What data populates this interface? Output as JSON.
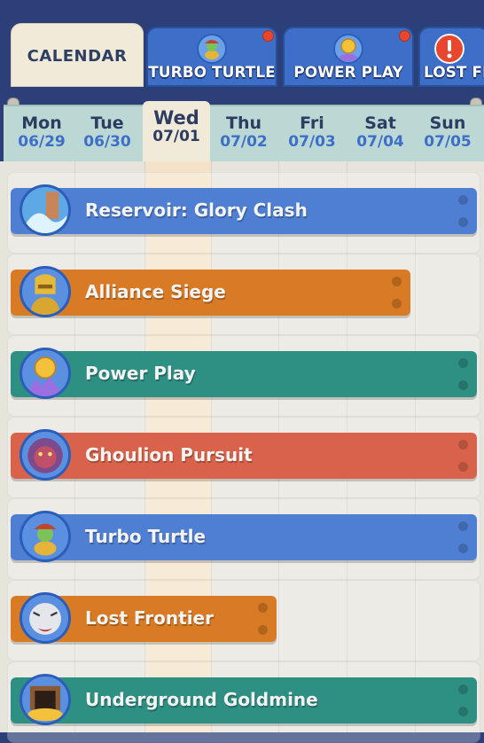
{
  "tabs": [
    {
      "label": "CALENDAR",
      "icon": "calendar",
      "active": true
    },
    {
      "label": "TURBO TURTLE",
      "icon": "turtle-icon",
      "notification": true
    },
    {
      "label": "POWER PLAY",
      "icon": "medal-crystal-icon",
      "notification": true
    },
    {
      "label": "LOST FI",
      "icon": "alert-icon",
      "notification": false
    }
  ],
  "days": [
    {
      "name": "Mon",
      "date": "06/29"
    },
    {
      "name": "Tue",
      "date": "06/30"
    },
    {
      "name": "Wed",
      "date": "07/01",
      "today": true
    },
    {
      "name": "Thu",
      "date": "07/02"
    },
    {
      "name": "Fri",
      "date": "07/03"
    },
    {
      "name": "Sat",
      "date": "07/04"
    },
    {
      "name": "Sun",
      "date": "07/05"
    }
  ],
  "events": [
    {
      "label": "Reservoir: Glory Clash",
      "icon": "reservoir-icon",
      "color": "#4f7fd3",
      "ends": "Sun"
    },
    {
      "label": "Alliance Siege",
      "icon": "golden-warrior-icon",
      "color": "#d97a24",
      "ends": "Sat"
    },
    {
      "label": "Power Play",
      "icon": "medal-crystal-icon",
      "color": "#2e8f83",
      "ends": "Sun"
    },
    {
      "label": "Ghoulion Pursuit",
      "icon": "ghoulion-icon",
      "color": "#d9634a",
      "ends": "Sun"
    },
    {
      "label": "Turbo Turtle",
      "icon": "turtle-icon",
      "color": "#4f7fd3",
      "ends": "Sun"
    },
    {
      "label": "Lost Frontier",
      "icon": "white-tiger-icon",
      "color": "#d97a24",
      "ends": "Thu"
    },
    {
      "label": "Underground Goldmine",
      "icon": "goldmine-icon",
      "color": "#2e8f83",
      "ends": "Sun"
    }
  ],
  "colors": {
    "header_bg": "#2c3f78",
    "tab_blue": "#3d6fc9",
    "active_cream": "#f2ead8",
    "today_column": "#f4e3c8",
    "notification_red": "#e8462e"
  }
}
